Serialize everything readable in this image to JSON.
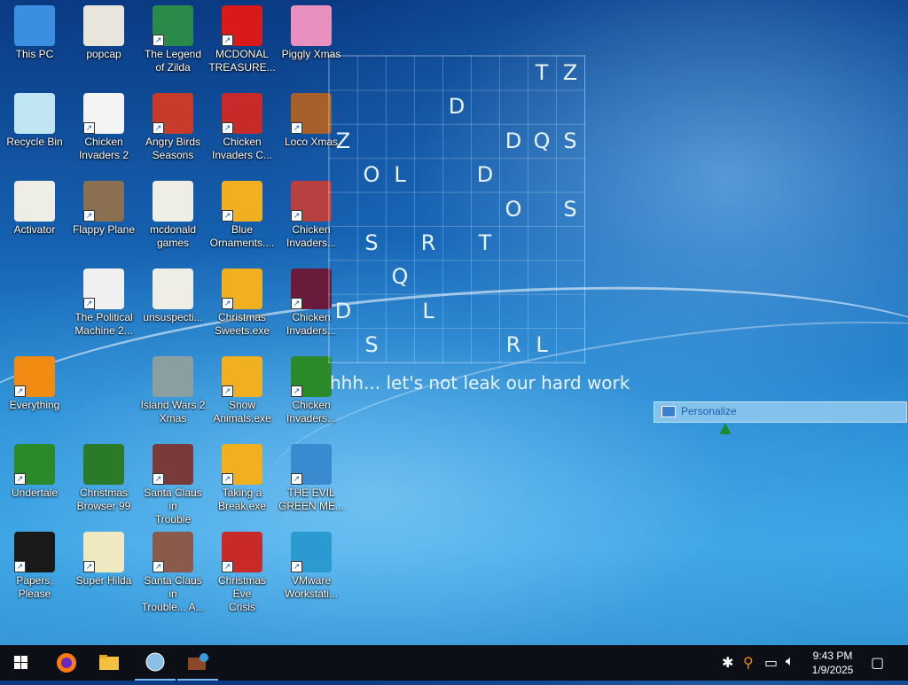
{
  "desktop": {
    "icons": [
      {
        "id": "this-pc",
        "label": "This PC",
        "shortcut": false,
        "color": "#3a8fe0"
      },
      {
        "id": "popcap",
        "label": "popcap",
        "shortcut": false,
        "color": "#e8e6dc"
      },
      {
        "id": "legend-of-zilda",
        "label": "The Legend\nof Zilda",
        "shortcut": true,
        "color": "#2a8a4a"
      },
      {
        "id": "mcdonal-treasure",
        "label": "MCDONAL\nTREASURE...",
        "shortcut": true,
        "color": "#d81a1a"
      },
      {
        "id": "piggly-xmas",
        "label": "Piggly Xmas",
        "shortcut": false,
        "color": "#e890c0"
      },
      {
        "id": "recycle-bin",
        "label": "Recycle Bin",
        "shortcut": false,
        "color": "#bfe6f2"
      },
      {
        "id": "chicken-invaders-2",
        "label": "Chicken\nInvaders 2",
        "shortcut": true,
        "color": "#f4f4f4"
      },
      {
        "id": "angry-birds-seasons",
        "label": "Angry Birds\nSeasons",
        "shortcut": true,
        "color": "#c83a2a"
      },
      {
        "id": "chicken-invaders-c",
        "label": "Chicken\nInvaders C...",
        "shortcut": true,
        "color": "#c82a2a"
      },
      {
        "id": "loco-xmas",
        "label": "Loco Xmas",
        "shortcut": true,
        "color": "#a8602a"
      },
      {
        "id": "activator",
        "label": "Activator",
        "shortcut": false,
        "color": "#eeeee6"
      },
      {
        "id": "flappy-plane",
        "label": "Flappy Plane",
        "shortcut": true,
        "color": "#8a7050"
      },
      {
        "id": "mcdonald-games",
        "label": "mcdonald\ngames",
        "shortcut": false,
        "color": "#eeeee6"
      },
      {
        "id": "blue-ornaments",
        "label": "Blue\nOrnaments....",
        "shortcut": true,
        "color": "#f0b020"
      },
      {
        "id": "chicken-invaders-3",
        "label": "Chicken\nInvaders...",
        "shortcut": true,
        "color": "#b84040"
      },
      {
        "id": "political-machine",
        "label": "The Political\nMachine 2...",
        "shortcut": true,
        "color": "#f0f0f0"
      },
      {
        "id": "unsuspecti",
        "label": "unsuspecti...",
        "shortcut": false,
        "color": "#eeeee6"
      },
      {
        "id": "christmas-sweets",
        "label": "Christmas\nSweets.exe",
        "shortcut": true,
        "color": "#f0b020"
      },
      {
        "id": "chicken-invaders-4",
        "label": "Chicken\nInvaders...",
        "shortcut": true,
        "color": "#6a1a3a"
      },
      {
        "id": "everything",
        "label": "Everything",
        "shortcut": true,
        "color": "#f08a10"
      },
      {
        "id": "island-wars",
        "label": "Island Wars 2\nXmas",
        "shortcut": false,
        "color": "#8aa0a0"
      },
      {
        "id": "snow-animals",
        "label": "Snow\nAnimals.exe",
        "shortcut": true,
        "color": "#f0b020"
      },
      {
        "id": "chicken-invaders-5",
        "label": "Chicken\nInvaders...",
        "shortcut": true,
        "color": "#2a8a2a"
      },
      {
        "id": "undertale",
        "label": "Undertale",
        "shortcut": true,
        "color": "#2a8a2a"
      },
      {
        "id": "christmas-browser",
        "label": "Christmas\nBrowser 99",
        "shortcut": false,
        "color": "#2a7a2a"
      },
      {
        "id": "santa-in-trouble",
        "label": "Santa Claus in\nTrouble",
        "shortcut": true,
        "color": "#7a3a3a"
      },
      {
        "id": "taking-a-break",
        "label": "Taking a\nBreak.exe",
        "shortcut": true,
        "color": "#f0b020"
      },
      {
        "id": "evil-green-me",
        "label": "THE EVIL\nGREEN ME...",
        "shortcut": true,
        "color": "#3a8ad0"
      },
      {
        "id": "papers-please",
        "label": "Papers, Please",
        "shortcut": true,
        "color": "#1a1a1a"
      },
      {
        "id": "super-hilda",
        "label": "Super Hilda",
        "shortcut": true,
        "color": "#f0e8c0"
      },
      {
        "id": "santa-in-trouble-a",
        "label": "Santa Claus in\nTrouble... A...",
        "shortcut": true,
        "color": "#8a5a4a"
      },
      {
        "id": "christmas-eve-crisis",
        "label": "Christmas Eve\nCrisis",
        "shortcut": true,
        "color": "#c82a2a"
      },
      {
        "id": "vmware",
        "label": "VMware\nWorkstati...",
        "shortcut": true,
        "color": "#2a9ad0"
      }
    ]
  },
  "wordgrid": {
    "letters": [
      {
        "ch": "T",
        "r": 0,
        "c": 7
      },
      {
        "ch": "Z",
        "r": 0,
        "c": 8
      },
      {
        "ch": "D",
        "r": 1,
        "c": 4
      },
      {
        "ch": "Z",
        "r": 2,
        "c": 0
      },
      {
        "ch": "D",
        "r": 2,
        "c": 6
      },
      {
        "ch": "Q",
        "r": 2,
        "c": 7
      },
      {
        "ch": "S",
        "r": 2,
        "c": 8
      },
      {
        "ch": "O",
        "r": 3,
        "c": 1
      },
      {
        "ch": "L",
        "r": 3,
        "c": 2
      },
      {
        "ch": "D",
        "r": 3,
        "c": 5
      },
      {
        "ch": "O",
        "r": 4,
        "c": 6
      },
      {
        "ch": "S",
        "r": 4,
        "c": 8
      },
      {
        "ch": "S",
        "r": 5,
        "c": 1
      },
      {
        "ch": "R",
        "r": 5,
        "c": 3
      },
      {
        "ch": "T",
        "r": 5,
        "c": 5
      },
      {
        "ch": "Q",
        "r": 6,
        "c": 2
      },
      {
        "ch": "D",
        "r": 7,
        "c": 0
      },
      {
        "ch": "L",
        "r": 7,
        "c": 3
      },
      {
        "ch": "S",
        "r": 8,
        "c": 1
      },
      {
        "ch": "R",
        "r": 8,
        "c": 6
      },
      {
        "ch": "L",
        "r": 8,
        "c": 7
      }
    ],
    "caption": "hhh... let's not leak our hard work"
  },
  "context_menu": {
    "item": "Personalize"
  },
  "taskbar": {
    "apps": [
      "windows-start-icon",
      "firefox-icon",
      "file-explorer-icon",
      "globe-app-icon",
      "package-app-icon"
    ],
    "clock": {
      "time": "9:43 PM",
      "date": "1/9/2025"
    }
  }
}
